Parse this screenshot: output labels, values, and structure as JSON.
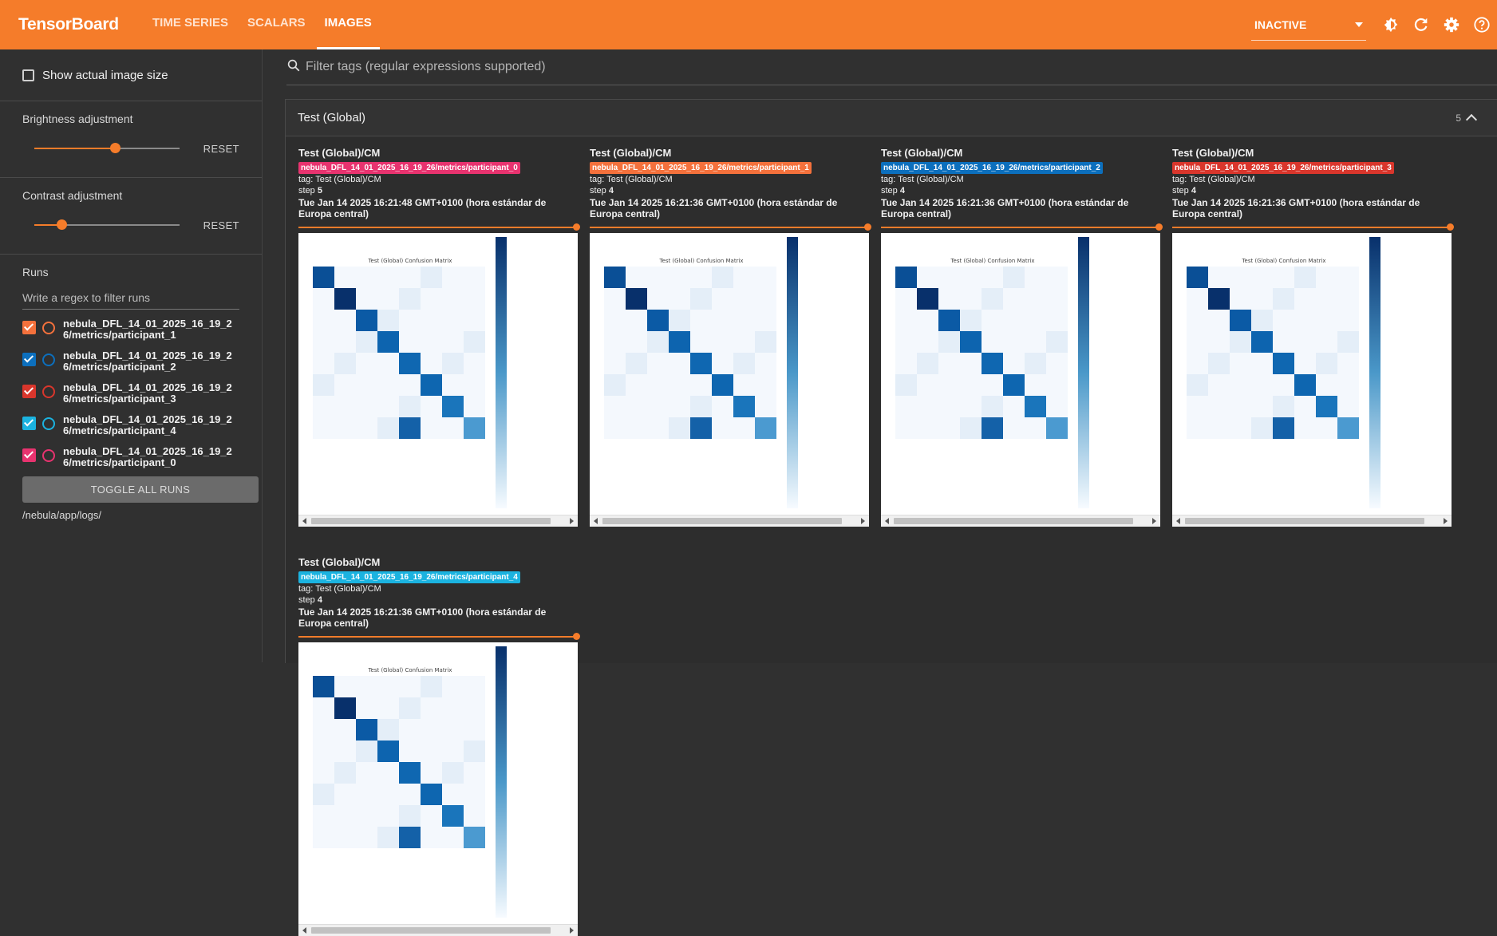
{
  "header": {
    "brand": "TensorBoard",
    "tabs": [
      {
        "label": "TIME SERIES",
        "active": false
      },
      {
        "label": "SCALARS",
        "active": false
      },
      {
        "label": "IMAGES",
        "active": true
      }
    ],
    "reload_status": "INACTIVE",
    "icons": [
      "brightness-icon",
      "refresh-icon",
      "settings-icon",
      "help-icon"
    ]
  },
  "sidebar": {
    "show_actual_size_label": "Show actual image size",
    "brightness": {
      "label": "Brightness adjustment",
      "value": 0.5,
      "reset": "RESET"
    },
    "contrast": {
      "label": "Contrast adjustment",
      "value": 0.17,
      "reset": "RESET"
    },
    "runs_title": "Runs",
    "runs_filter_placeholder": "Write a regex to filter runs",
    "runs": [
      {
        "name": "nebula_DFL_14_01_2025_16_19_26/metrics/participant_1",
        "color": "#f4713c",
        "checked": true
      },
      {
        "name": "nebula_DFL_14_01_2025_16_19_26/metrics/participant_2",
        "color": "#0c6fbd",
        "checked": true
      },
      {
        "name": "nebula_DFL_14_01_2025_16_19_26/metrics/participant_3",
        "color": "#d9362c",
        "checked": true
      },
      {
        "name": "nebula_DFL_14_01_2025_16_19_26/metrics/participant_4",
        "color": "#1bb3e0",
        "checked": true
      },
      {
        "name": "nebula_DFL_14_01_2025_16_19_26/metrics/participant_0",
        "color": "#e8336f",
        "checked": true
      }
    ],
    "toggle_all": "TOGGLE ALL RUNS",
    "log_dir": "/nebula/app/logs/"
  },
  "main": {
    "filter_placeholder": "Filter tags (regular expressions supported)",
    "group": {
      "title": "Test (Global)",
      "count": "5"
    },
    "cards": [
      {
        "title": "Test (Global)/CM",
        "run": "nebula_DFL_14_01_2025_16_19_26/metrics/participant_0",
        "run_color": "#e8336f",
        "tag": "tag: Test (Global)/CM",
        "step_label": "step",
        "step": "5",
        "timestamp": "Tue Jan 14 2025 16:21:48 GMT+0100 (hora estándar de Europa central)",
        "image_title": "Test (Global) Confusion Matrix"
      },
      {
        "title": "Test (Global)/CM",
        "run": "nebula_DFL_14_01_2025_16_19_26/metrics/participant_1",
        "run_color": "#f4713c",
        "tag": "tag: Test (Global)/CM",
        "step_label": "step",
        "step": "4",
        "timestamp": "Tue Jan 14 2025 16:21:36 GMT+0100 (hora estándar de Europa central)",
        "image_title": "Test (Global) Confusion Matrix"
      },
      {
        "title": "Test (Global)/CM",
        "run": "nebula_DFL_14_01_2025_16_19_26/metrics/participant_2",
        "run_color": "#0c6fbd",
        "tag": "tag: Test (Global)/CM",
        "step_label": "step",
        "step": "4",
        "timestamp": "Tue Jan 14 2025 16:21:36 GMT+0100 (hora estándar de Europa central)",
        "image_title": "Test (Global) Confusion Matrix"
      },
      {
        "title": "Test (Global)/CM",
        "run": "nebula_DFL_14_01_2025_16_19_26/metrics/participant_3",
        "run_color": "#d9362c",
        "tag": "tag: Test (Global)/CM",
        "step_label": "step",
        "step": "4",
        "timestamp": "Tue Jan 14 2025 16:21:36 GMT+0100 (hora estándar de Europa central)",
        "image_title": "Test (Global) Confusion Matrix"
      },
      {
        "title": "Test (Global)/CM",
        "run": "nebula_DFL_14_01_2025_16_19_26/metrics/participant_4",
        "run_color": "#1bb3e0",
        "tag": "tag: Test (Global)/CM",
        "step_label": "step",
        "step": "4",
        "timestamp": "Tue Jan 14 2025 16:21:36 GMT+0100 (hora estándar de Europa central)",
        "image_title": "Test (Global) Confusion Matrix"
      }
    ]
  }
}
